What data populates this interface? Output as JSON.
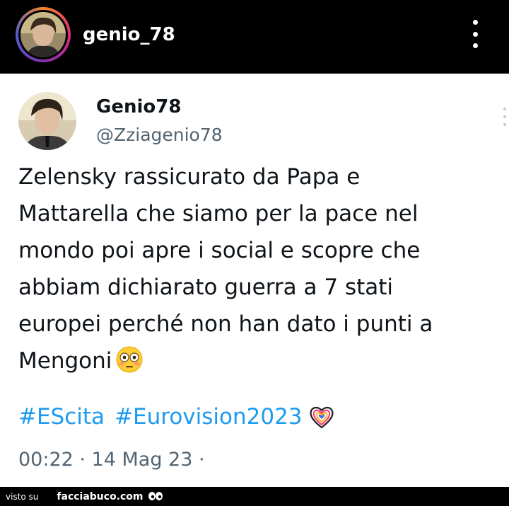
{
  "header": {
    "username": "genio_78"
  },
  "tweet": {
    "name": "Genio78",
    "handle": "@Zziagenio78",
    "text_lines": [
      "Zelensky rassicurato da Papa e",
      "Mattarella che siamo per la pace nel",
      "mondo poi apre i social e scopre che",
      "abbiam dichiarato guerra a 7 stati",
      "europei perché non han dato i punti a",
      "Mengoni"
    ],
    "emoji": "flushed-face",
    "hashtags": [
      "#EScita",
      "#Eurovision2023"
    ],
    "hashtag_emoji": "eurovision-heart",
    "timestamp": "00:22 · 14 Mag 23 ·"
  },
  "footer": {
    "prefix": "visto su",
    "site": "facciabuco.com"
  },
  "colors": {
    "link": "#1d9bf0",
    "secondary_text": "#536471",
    "header_bg": "#000000"
  }
}
